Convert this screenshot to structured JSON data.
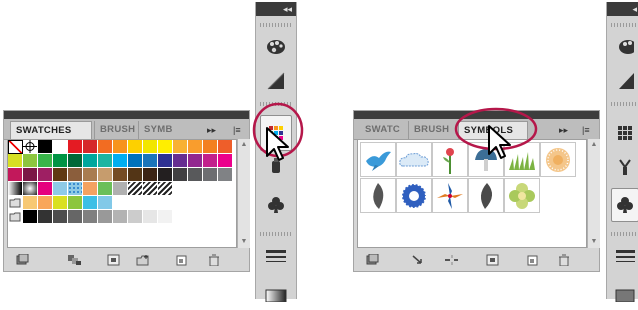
{
  "left_panel": {
    "tabs": [
      "SWATCHES",
      "BRUSH",
      "SYMB"
    ],
    "menu_glyph": "▸▸",
    "menu_lines": "|≡",
    "swatch_rows": [
      [
        "none",
        "reg",
        "#000000",
        "#ffffff",
        "#e41b23",
        "#d6272a",
        "#f26c22",
        "#f7941d",
        "#fdd000",
        "#f2e600",
        "#ffee00",
        "#f8b133",
        "#f99d2d",
        "#f38020",
        "#ee5e2a"
      ],
      [
        "#d7df23",
        "#8dc63f",
        "#39b54a",
        "#009444",
        "#006838",
        "#00a79d",
        "#1bb5a2",
        "#00aeef",
        "#0072bc",
        "#1b75bb",
        "#2e3192",
        "#662d91",
        "#92278f",
        "#c2208c",
        "#ec008c"
      ],
      [
        "#c2185b",
        "#7b1746",
        "#9e1f63",
        "#603913",
        "#8b5e3c",
        "#a97c50",
        "#c69c6d",
        "#754c24",
        "#533516",
        "#3c2415",
        "#231f20",
        "#414042",
        "#58595b",
        "#6d6e71",
        "#808285"
      ]
    ],
    "swatch_row4": [
      "grad-black",
      "grad-rad",
      "#e5007e",
      "#8ecae6",
      "pat-dots",
      "#f4a261",
      "#6bbf59",
      "#b0b0b0",
      "pat-diag",
      "pat-diag2",
      "pat-diag3"
    ],
    "swatch_row5": [
      "folder",
      "#f7c873",
      "#f9a65a",
      "#d9e021",
      "#8cc63e",
      "#3dbfe6",
      "#82c9e8"
    ],
    "swatch_row6": [
      "folder",
      "#000000",
      "#333333",
      "#4d4d4d",
      "#666666",
      "#808080",
      "#999999",
      "#b3b3b3",
      "#cccccc",
      "#e6e6e6",
      "#f2f2f2"
    ]
  },
  "right_panel": {
    "tabs": [
      "SWATC",
      "BRUSH",
      "SYMBOLS"
    ],
    "menu_glyph": "▸▸",
    "menu_lines": "|≡",
    "symbols_row1": [
      "bird-symbol",
      "cloud-symbol",
      "flower-symbol",
      "mushroom-symbol",
      "grass-symbol",
      "dot-flower-symbol"
    ],
    "symbols_row2": [
      "leaf-symbol",
      "blue-flower-symbol",
      "pinwheel-symbol",
      "dark-leaf-symbol",
      "green-flower-symbol"
    ]
  },
  "dock": {
    "collapse_glyph": "◂◂",
    "right_collapse_glyph": "◂"
  },
  "colors": {
    "highlight_ring": "#b5174a",
    "panel_bg": "#d6d6d6",
    "dock_top": "#3b3b3b"
  }
}
